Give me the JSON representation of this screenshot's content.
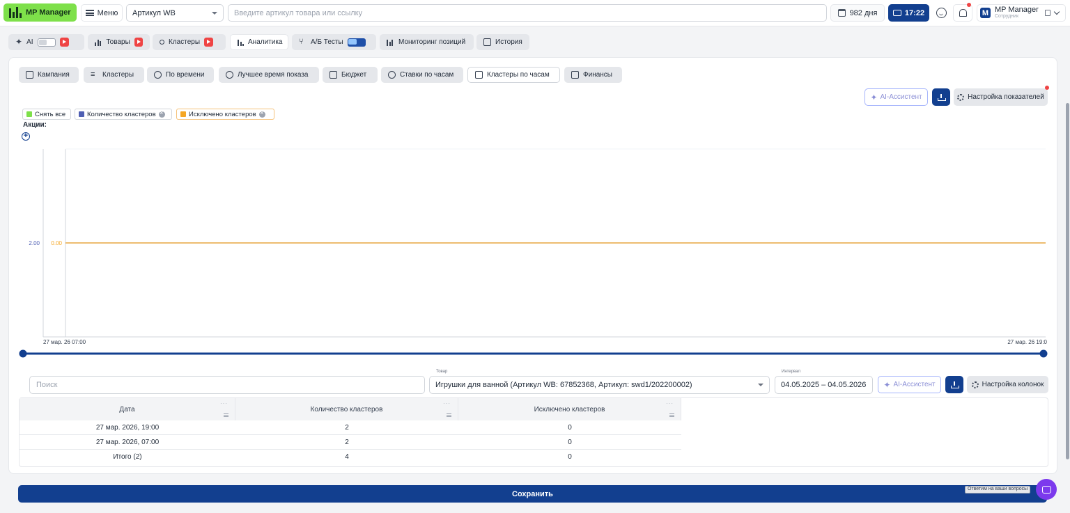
{
  "header": {
    "brand": "MP Manager",
    "menu_label": "Меню",
    "article_select": "Артикул WB",
    "search_placeholder": "Введите артикул товара или ссылку",
    "days_label": "982 дня",
    "time_label": "17:22",
    "user_initial": "M",
    "user_name": "MP Manager",
    "user_role": "Сотрудник"
  },
  "main_tabs": [
    {
      "label": "AI"
    },
    {
      "label": "Товары"
    },
    {
      "label": "Кластеры"
    },
    {
      "label": "Аналитика"
    },
    {
      "label": "А/Б Тесты"
    },
    {
      "label": "Мониторинг позиций"
    },
    {
      "label": "История"
    }
  ],
  "sub_tabs": [
    {
      "label": "Кампания"
    },
    {
      "label": "Кластеры"
    },
    {
      "label": "По времени"
    },
    {
      "label": "Лучшее время показа"
    },
    {
      "label": "Бюджет"
    },
    {
      "label": "Ставки по часам"
    },
    {
      "label": "Кластеры по часам"
    },
    {
      "label": "Финансы"
    }
  ],
  "chart_toolbar": {
    "ai_label": "AI-Ассистент",
    "settings_label": "Настройка показателей"
  },
  "legend": {
    "deselect_all": "Снять все",
    "items": [
      {
        "label": "Количество кластеров",
        "color": "#4f5fb3"
      },
      {
        "label": "Исключено кластеров",
        "color": "#f5a623"
      }
    ]
  },
  "actions_label": "Акции:",
  "chart_data": {
    "type": "line",
    "x": [
      "27 мар. 26 07:00",
      "27 мар. 26 19:0"
    ],
    "series": [
      {
        "name": "Количество кластеров",
        "values": [
          2,
          2
        ],
        "color": "#4f5fb3"
      },
      {
        "name": "Исключено кластеров",
        "values": [
          0,
          0
        ],
        "color": "#f5a623"
      }
    ],
    "y_tick_left": "2.00",
    "y_tick_right": "0.00"
  },
  "filters": {
    "search_placeholder": "Поиск",
    "product_label": "Товар",
    "product_value": "Игрушки для ванной (Артикул WB: 67852368, Артикул: swd1/202200002)",
    "interval_label": "Интервал",
    "interval_value": "04.05.2025 – 04.05.2026",
    "ai_label": "AI-Ассистент",
    "settings_label": "Настройка колонок"
  },
  "table": {
    "columns": [
      "Дата",
      "Количество кластеров",
      "Исключено кластеров"
    ],
    "rows": [
      [
        "27 мар. 2026, 19:00",
        "2",
        "0"
      ],
      [
        "27 мар. 2026, 07:00",
        "2",
        "0"
      ],
      [
        "Итого (2)",
        "4",
        "0"
      ]
    ]
  },
  "footer": {
    "save_label": "Сохранить",
    "help_tip": "Ответим на ваши вопросы"
  },
  "colors": {
    "brand_green": "#7ee04a",
    "primary_blue": "#123f8f"
  }
}
